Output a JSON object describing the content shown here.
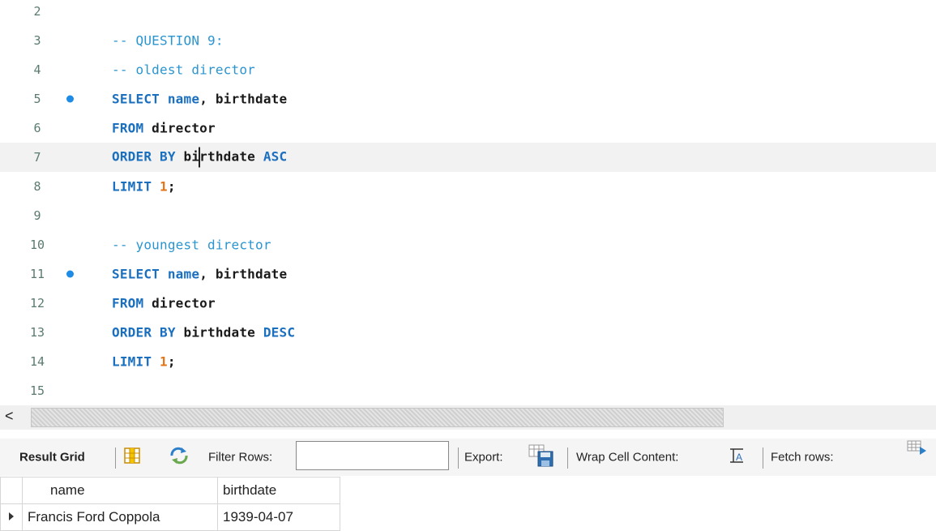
{
  "editor": {
    "lines": [
      {
        "num": "2",
        "parts": []
      },
      {
        "num": "3",
        "parts": [
          {
            "t": "cm",
            "v": "-- QUESTION 9:"
          }
        ]
      },
      {
        "num": "4",
        "parts": [
          {
            "t": "cm",
            "v": "-- oldest director"
          }
        ]
      },
      {
        "num": "5",
        "marker": true,
        "parts": [
          {
            "t": "kw",
            "v": "SELECT "
          },
          {
            "t": "kw",
            "v": "name"
          },
          {
            "t": "id",
            "v": ", birthdate"
          }
        ]
      },
      {
        "num": "6",
        "parts": [
          {
            "t": "kw",
            "v": "FROM "
          },
          {
            "t": "id",
            "v": "director"
          }
        ]
      },
      {
        "num": "7",
        "current": true,
        "parts": [
          {
            "t": "kw",
            "v": "ORDER BY "
          },
          {
            "t": "id",
            "v": "bi"
          },
          {
            "t": "caret",
            "v": ""
          },
          {
            "t": "id",
            "v": "rthdate "
          },
          {
            "t": "kw",
            "v": "ASC"
          }
        ]
      },
      {
        "num": "8",
        "parts": [
          {
            "t": "kw",
            "v": "LIMIT "
          },
          {
            "t": "num",
            "v": "1"
          },
          {
            "t": "id",
            "v": ";"
          }
        ]
      },
      {
        "num": "9",
        "parts": []
      },
      {
        "num": "10",
        "parts": [
          {
            "t": "cm",
            "v": "-- youngest director"
          }
        ]
      },
      {
        "num": "11",
        "marker": true,
        "parts": [
          {
            "t": "kw",
            "v": "SELECT "
          },
          {
            "t": "kw",
            "v": "name"
          },
          {
            "t": "id",
            "v": ", birthdate"
          }
        ]
      },
      {
        "num": "12",
        "parts": [
          {
            "t": "kw",
            "v": "FROM "
          },
          {
            "t": "id",
            "v": "director"
          }
        ]
      },
      {
        "num": "13",
        "parts": [
          {
            "t": "kw",
            "v": "ORDER BY "
          },
          {
            "t": "id",
            "v": "birthdate "
          },
          {
            "t": "kw",
            "v": "DESC"
          }
        ]
      },
      {
        "num": "14",
        "parts": [
          {
            "t": "kw",
            "v": "LIMIT "
          },
          {
            "t": "num",
            "v": "1"
          },
          {
            "t": "id",
            "v": ";"
          }
        ]
      },
      {
        "num": "15",
        "parts": []
      }
    ]
  },
  "scrollbar": {
    "left_arrow": "<"
  },
  "toolbar": {
    "result_grid": "Result Grid",
    "filter_rows": "Filter Rows:",
    "filter_value": "",
    "export": "Export:",
    "wrap_cell": "Wrap Cell Content:",
    "fetch_rows": "Fetch rows:"
  },
  "results": {
    "columns": [
      "name",
      "birthdate"
    ],
    "rows": [
      [
        "Francis Ford Coppola",
        "1939-04-07"
      ]
    ]
  },
  "colors": {
    "keyword": "#1a6fbf",
    "comment": "#2a95cf",
    "number": "#e0761a",
    "marker": "#1e8ce6"
  }
}
